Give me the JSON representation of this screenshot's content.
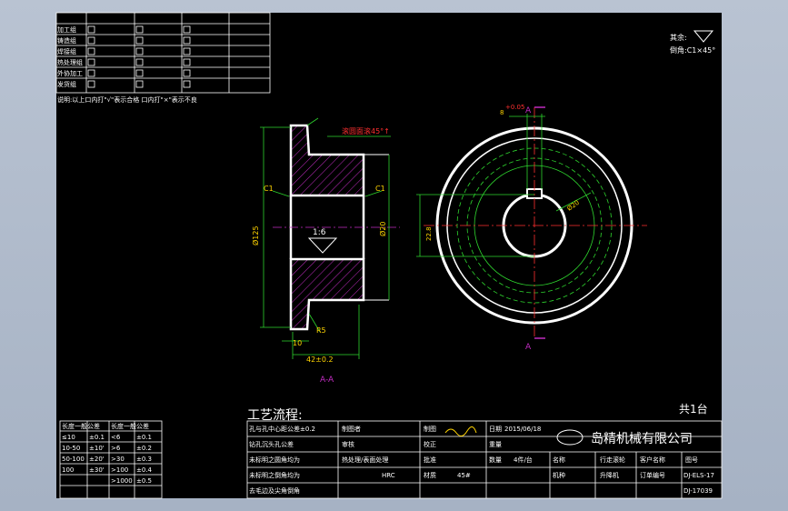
{
  "title_block_top_left": {
    "rows": [
      "加工组",
      "铸造组",
      "焊接组",
      "热处理组",
      "外协加工",
      "发货组"
    ],
    "note": "说明:以上口内打\"√\"表示合格 口内打\"×\"表示不良"
  },
  "top_right": {
    "roughness_label": "其余:",
    "chamfer_note": "倒角:C1×45°"
  },
  "drawing": {
    "section_label": "A-A",
    "knurl_note": "滚圆面滚45°↑",
    "dim_left_c1": "C1",
    "dim_right_c1": "C1",
    "dim_bore": "Ø20",
    "dim_outer": "Ø125",
    "taper": "1:6",
    "length_dim": "42±0.2",
    "small_dim": "10",
    "chamfer_r": "R5",
    "section_marker_top": "A",
    "section_marker_bottom": "A",
    "keyway_width": "8",
    "keyway_tol_top": "+0.05",
    "keyway_tol_bottom": "+0.02",
    "bore_dim": "Ø20",
    "bore_tol_top": "+0.05",
    "bore_tol_bottom": "+0.02",
    "depth_dim": "22.8",
    "depth_tol_top": "+0.10",
    "depth_tol_bottom": "0"
  },
  "process": {
    "title": "工艺流程:",
    "count_label": "共1台",
    "notes": [
      "孔与孔中心距公差±0.2",
      "钻孔沉头孔公差",
      "未标明之圆角均为",
      "未标明之倒角均为",
      "去毛边及尖角倒角"
    ],
    "surface": "热处理/表面处理",
    "hardness": "HRC"
  },
  "tolerance_table": {
    "header": [
      "长度一般公差",
      "长度一般公差"
    ],
    "rows": [
      [
        "≤10",
        "±0.1",
        "<6",
        "±0.1"
      ],
      [
        "10-50",
        "±10'",
        ">6",
        "±0.2"
      ],
      [
        "50-100",
        "±20'",
        ">30",
        "±0.3"
      ],
      [
        "100",
        "±30'",
        ">100",
        "±0.4"
      ],
      [
        "",
        "",
        ">1000",
        "±0.5"
      ]
    ]
  },
  "title_block": {
    "drawn_by": "制图者",
    "checked_by": "审核",
    "approved": "批准",
    "drawing_label": "制图",
    "check_label": "校正",
    "date_label": "日期",
    "date": "2015/06/18",
    "weight_label": "重量",
    "qty_label": "数量",
    "qty": "4件/台",
    "material_label": "材质",
    "material": "45#",
    "company": "岛精机械有限公司",
    "name_label": "名称",
    "part_name": "行走滚轮",
    "customer_label": "客户名称",
    "drawing_no_label": "图号",
    "drawing_no": "DJ-ELS-17",
    "model_label": "机种",
    "model": "升降机",
    "customer_no_label": "订单编号",
    "material2_label": "图档",
    "drawing_no2": "DJ-17039",
    "version_label": "版次"
  }
}
